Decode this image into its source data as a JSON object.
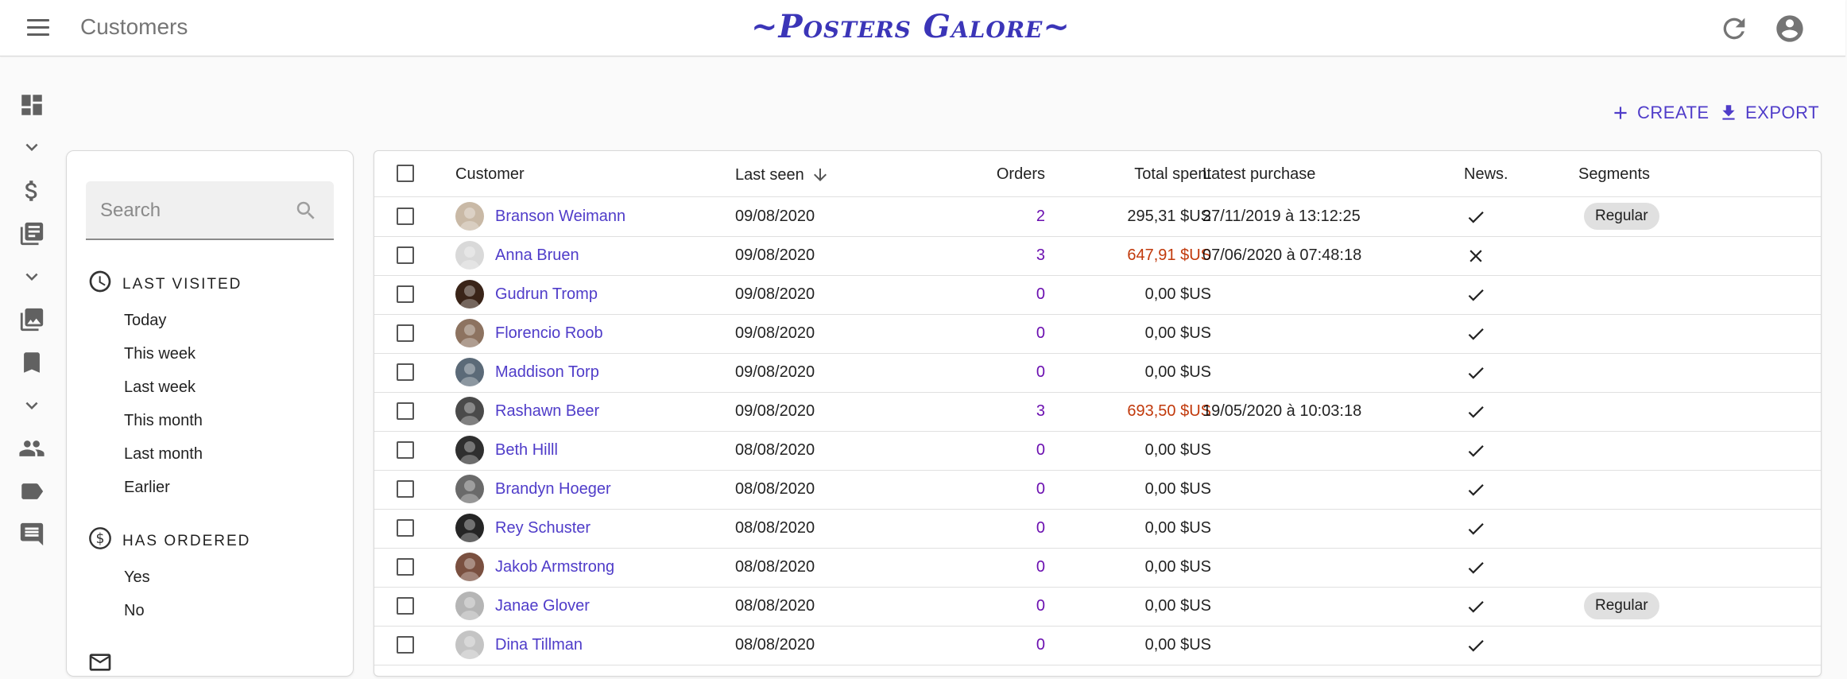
{
  "appbar": {
    "title": "Customers",
    "brand": "~Posters Galore~"
  },
  "icons": {
    "menu": "menu-icon",
    "refresh": "refresh-icon",
    "account": "account-circle-icon"
  },
  "sidebar": {
    "items": [
      {
        "name": "dashboard-icon"
      },
      {
        "name": "chevron-down-icon"
      },
      {
        "name": "dollar-icon"
      },
      {
        "name": "book-icon"
      },
      {
        "name": "chevron-down-icon"
      },
      {
        "name": "photo-library-icon"
      },
      {
        "name": "bookmark-icon"
      },
      {
        "name": "chevron-down-icon"
      },
      {
        "name": "people-icon"
      },
      {
        "name": "label-icon"
      },
      {
        "name": "comment-icon"
      }
    ]
  },
  "toolbar": {
    "create_label": "CREATE",
    "export_label": "EXPORT"
  },
  "filters": {
    "search_placeholder": "Search",
    "last_visited": {
      "title": "Last visited",
      "options": [
        "Today",
        "This week",
        "Last week",
        "This month",
        "Last month",
        "Earlier"
      ]
    },
    "has_ordered": {
      "title": "Has ordered",
      "options": [
        "Yes",
        "No"
      ]
    }
  },
  "table": {
    "columns": {
      "customer": "Customer",
      "last_seen": "Last seen",
      "orders": "Orders",
      "total_spent": "Total spent",
      "latest_purchase": "Latest purchase",
      "news": "News.",
      "segments": "Segments"
    },
    "sort": {
      "column": "last_seen",
      "direction": "desc"
    },
    "rows": [
      {
        "name": "Branson Weimann",
        "last_seen": "09/08/2020",
        "orders": "2",
        "total_spent": "295,31 $US",
        "high": false,
        "latest_purchase": "27/11/2019 à 13:12:25",
        "news": true,
        "segment": "Regular",
        "avatar_color": "#c9b9a6"
      },
      {
        "name": "Anna Bruen",
        "last_seen": "09/08/2020",
        "orders": "3",
        "total_spent": "647,91 $US",
        "high": true,
        "latest_purchase": "07/06/2020 à 07:48:18",
        "news": false,
        "segment": "",
        "avatar_color": "#d9d9d9"
      },
      {
        "name": "Gudrun Tromp",
        "last_seen": "09/08/2020",
        "orders": "0",
        "total_spent": "0,00 $US",
        "high": false,
        "latest_purchase": "",
        "news": true,
        "segment": "",
        "avatar_color": "#3a2418"
      },
      {
        "name": "Florencio Roob",
        "last_seen": "09/08/2020",
        "orders": "0",
        "total_spent": "0,00 $US",
        "high": false,
        "latest_purchase": "",
        "news": true,
        "segment": "",
        "avatar_color": "#8d7360"
      },
      {
        "name": "Maddison Torp",
        "last_seen": "09/08/2020",
        "orders": "0",
        "total_spent": "0,00 $US",
        "high": false,
        "latest_purchase": "",
        "news": true,
        "segment": "",
        "avatar_color": "#5b6a78"
      },
      {
        "name": "Rashawn Beer",
        "last_seen": "09/08/2020",
        "orders": "3",
        "total_spent": "693,50 $US",
        "high": true,
        "latest_purchase": "19/05/2020 à 10:03:18",
        "news": true,
        "segment": "",
        "avatar_color": "#4a4a4a"
      },
      {
        "name": "Beth Hilll",
        "last_seen": "08/08/2020",
        "orders": "0",
        "total_spent": "0,00 $US",
        "high": false,
        "latest_purchase": "",
        "news": true,
        "segment": "",
        "avatar_color": "#2f2f2f"
      },
      {
        "name": "Brandyn Hoeger",
        "last_seen": "08/08/2020",
        "orders": "0",
        "total_spent": "0,00 $US",
        "high": false,
        "latest_purchase": "",
        "news": true,
        "segment": "",
        "avatar_color": "#6a6a6a"
      },
      {
        "name": "Rey Schuster",
        "last_seen": "08/08/2020",
        "orders": "0",
        "total_spent": "0,00 $US",
        "high": false,
        "latest_purchase": "",
        "news": true,
        "segment": "",
        "avatar_color": "#252525"
      },
      {
        "name": "Jakob Armstrong",
        "last_seen": "08/08/2020",
        "orders": "0",
        "total_spent": "0,00 $US",
        "high": false,
        "latest_purchase": "",
        "news": true,
        "segment": "",
        "avatar_color": "#7a5040"
      },
      {
        "name": "Janae Glover",
        "last_seen": "08/08/2020",
        "orders": "0",
        "total_spent": "0,00 $US",
        "high": false,
        "latest_purchase": "",
        "news": true,
        "segment": "Regular",
        "avatar_color": "#b5b5b5"
      },
      {
        "name": "Dina Tillman",
        "last_seen": "08/08/2020",
        "orders": "0",
        "total_spent": "0,00 $US",
        "high": false,
        "latest_purchase": "",
        "news": true,
        "segment": "",
        "avatar_color": "#c4c4c4"
      }
    ]
  },
  "colors": {
    "accent": "#4f3cc9",
    "orders": "#6b0fb0",
    "high_spend": "#c1390b"
  }
}
